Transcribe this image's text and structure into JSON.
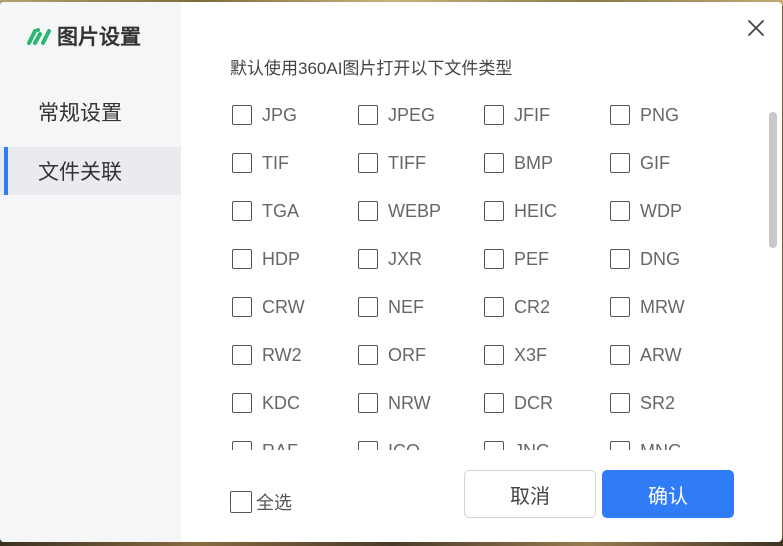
{
  "app": {
    "title": "图片设置",
    "accent_color": "#2f7cf6"
  },
  "sidebar": {
    "items": [
      {
        "label": "常规设置",
        "active": false
      },
      {
        "label": "文件关联",
        "active": true
      }
    ]
  },
  "content": {
    "heading": "默认使用360AI图片打开以下文件类型",
    "file_types": [
      {
        "label": "JPG",
        "checked": false
      },
      {
        "label": "JPEG",
        "checked": false
      },
      {
        "label": "JFIF",
        "checked": false
      },
      {
        "label": "PNG",
        "checked": false
      },
      {
        "label": "TIF",
        "checked": false
      },
      {
        "label": "TIFF",
        "checked": false
      },
      {
        "label": "BMP",
        "checked": false
      },
      {
        "label": "GIF",
        "checked": false
      },
      {
        "label": "TGA",
        "checked": false
      },
      {
        "label": "WEBP",
        "checked": false
      },
      {
        "label": "HEIC",
        "checked": false
      },
      {
        "label": "WDP",
        "checked": false
      },
      {
        "label": "HDP",
        "checked": false
      },
      {
        "label": "JXR",
        "checked": false
      },
      {
        "label": "PEF",
        "checked": false
      },
      {
        "label": "DNG",
        "checked": false
      },
      {
        "label": "CRW",
        "checked": false
      },
      {
        "label": "NEF",
        "checked": false
      },
      {
        "label": "CR2",
        "checked": false
      },
      {
        "label": "MRW",
        "checked": false
      },
      {
        "label": "RW2",
        "checked": false
      },
      {
        "label": "ORF",
        "checked": false
      },
      {
        "label": "X3F",
        "checked": false
      },
      {
        "label": "ARW",
        "checked": false
      },
      {
        "label": "KDC",
        "checked": false
      },
      {
        "label": "NRW",
        "checked": false
      },
      {
        "label": "DCR",
        "checked": false
      },
      {
        "label": "SR2",
        "checked": false
      },
      {
        "label": "RAF",
        "checked": false
      },
      {
        "label": "ICO",
        "checked": false
      },
      {
        "label": "JNG",
        "checked": false
      },
      {
        "label": "MNG",
        "checked": false
      }
    ]
  },
  "footer": {
    "select_all_label": "全选",
    "cancel_label": "取消",
    "confirm_label": "确认"
  },
  "icons": {
    "logo": "app-logo-icon",
    "close": "close-icon"
  }
}
